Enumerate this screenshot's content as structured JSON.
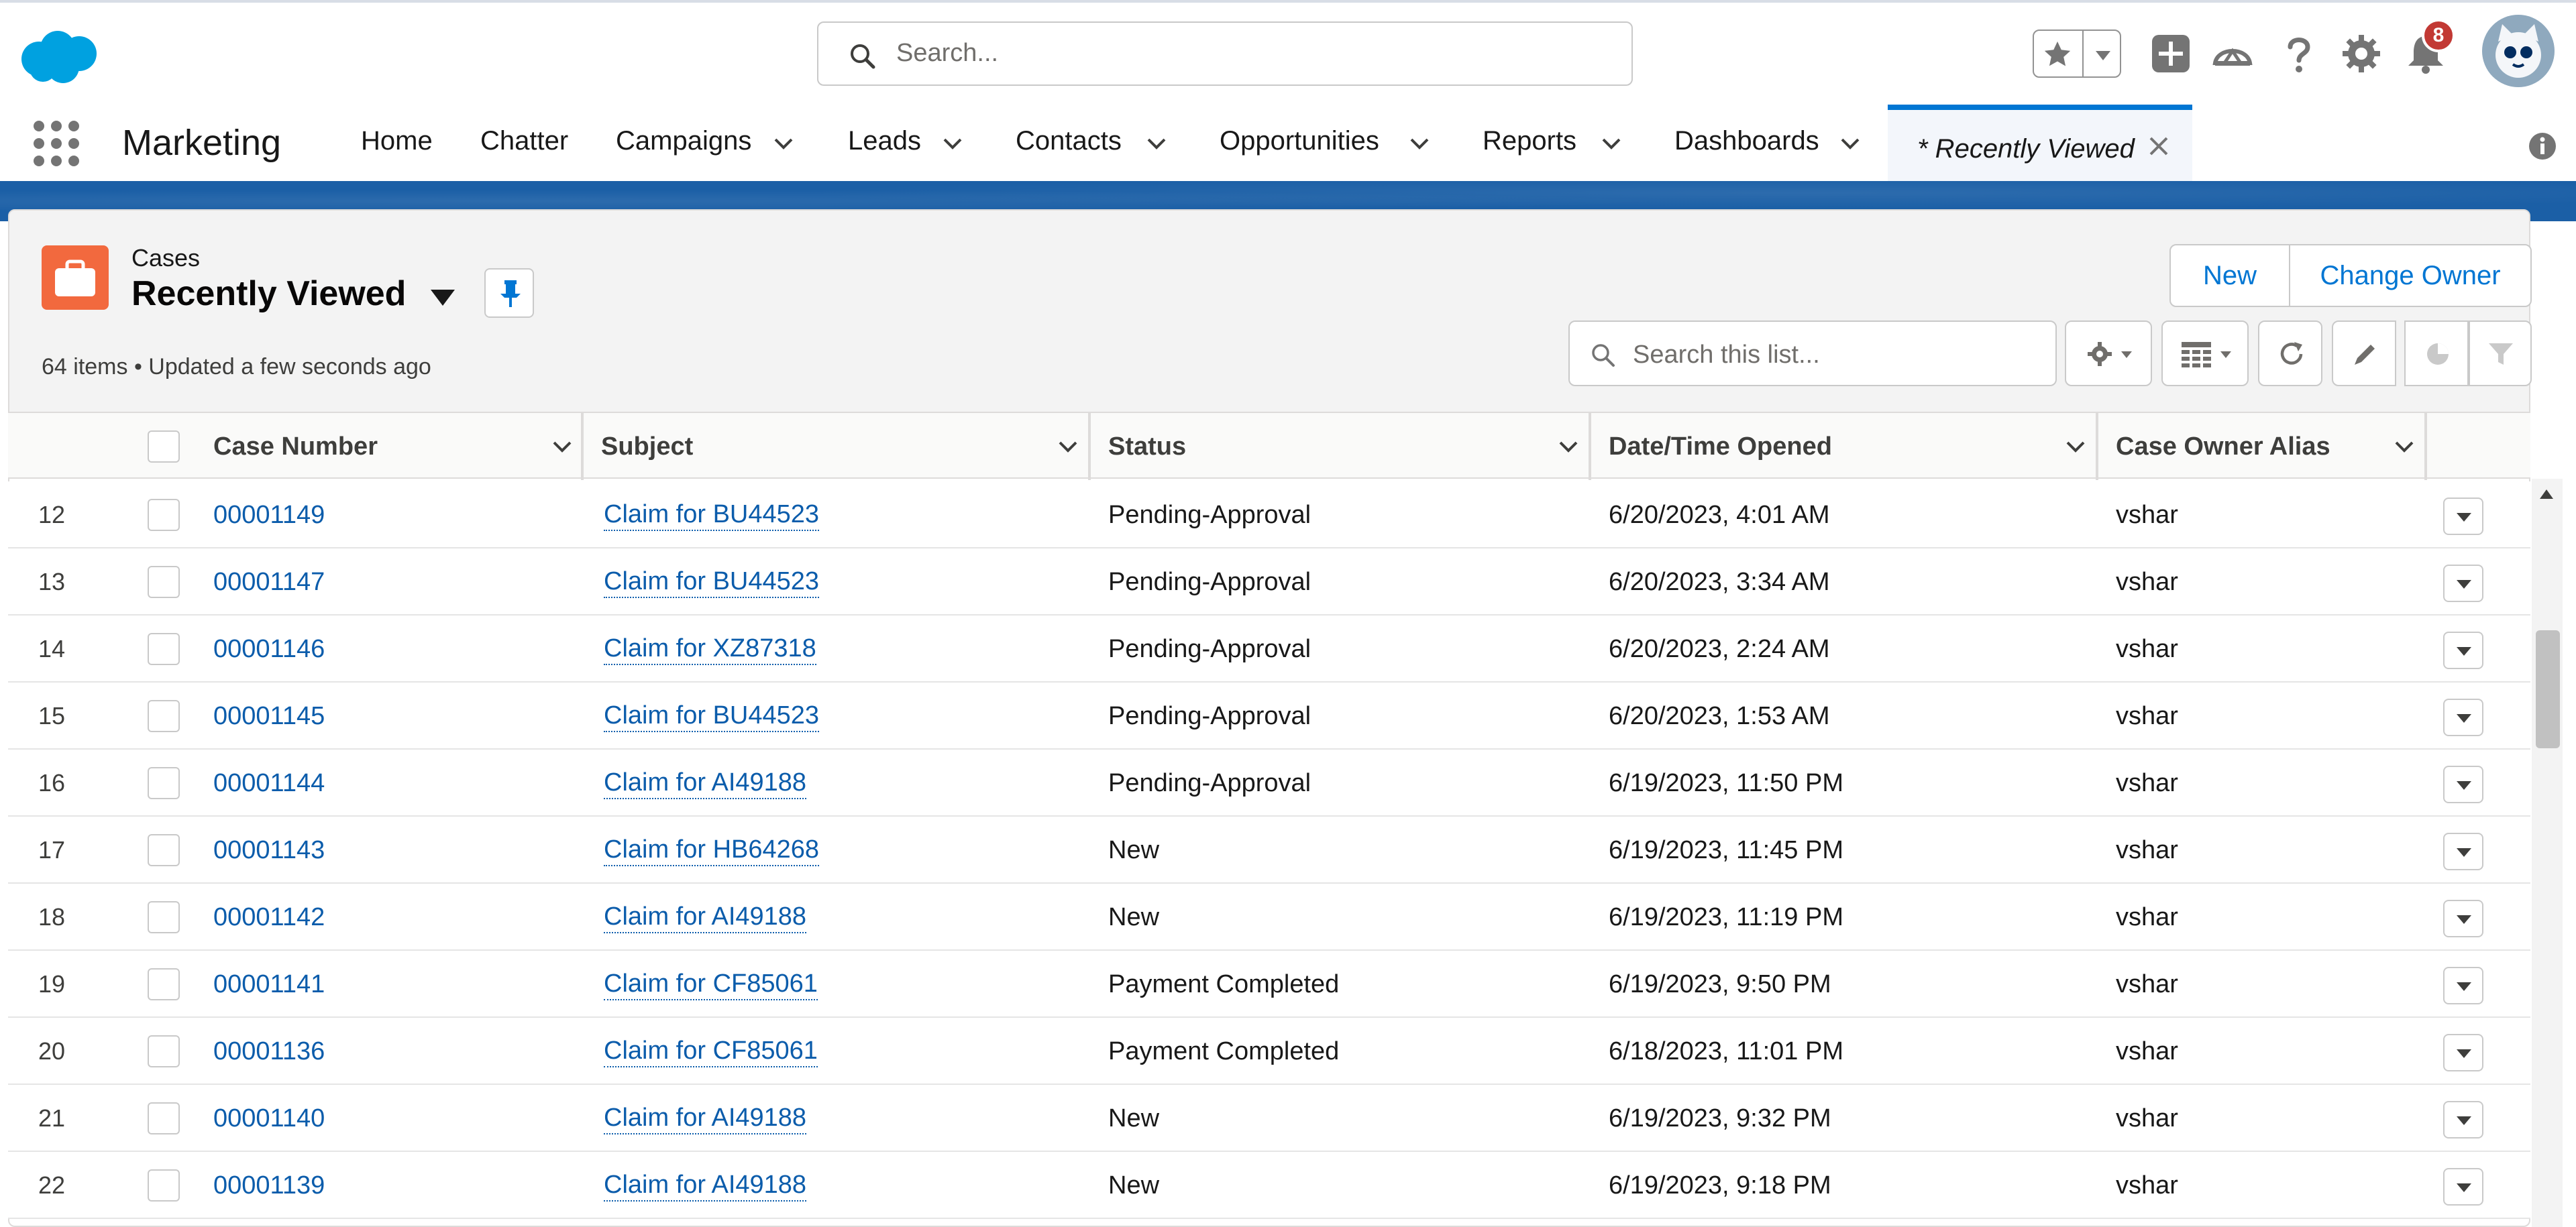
{
  "header": {
    "search_placeholder": "Search...",
    "notification_count": "8"
  },
  "nav": {
    "app_name": "Marketing",
    "items": [
      {
        "label": "Home",
        "has_menu": false
      },
      {
        "label": "Chatter",
        "has_menu": false
      },
      {
        "label": "Campaigns",
        "has_menu": true
      },
      {
        "label": "Leads",
        "has_menu": true
      },
      {
        "label": "Contacts",
        "has_menu": true
      },
      {
        "label": "Opportunities",
        "has_menu": true
      },
      {
        "label": "Reports",
        "has_menu": true
      },
      {
        "label": "Dashboards",
        "has_menu": true
      }
    ],
    "active_tab": "* Recently Viewed"
  },
  "list": {
    "object_label": "Cases",
    "title": "Recently Viewed",
    "meta": "64 items • Updated a few seconds ago",
    "btn_new": "New",
    "btn_change_owner": "Change Owner",
    "search_placeholder": "Search this list..."
  },
  "table": {
    "columns": [
      "Case Number",
      "Subject",
      "Status",
      "Date/Time Opened",
      "Case Owner Alias"
    ],
    "rows": [
      {
        "num": "12",
        "case_number": "00001149",
        "subject": "Claim for BU44523",
        "status": "Pending-Approval",
        "opened": "6/20/2023, 4:01 AM",
        "owner": "vshar"
      },
      {
        "num": "13",
        "case_number": "00001147",
        "subject": "Claim for BU44523",
        "status": "Pending-Approval",
        "opened": "6/20/2023, 3:34 AM",
        "owner": "vshar"
      },
      {
        "num": "14",
        "case_number": "00001146",
        "subject": "Claim for XZ87318",
        "status": "Pending-Approval",
        "opened": "6/20/2023, 2:24 AM",
        "owner": "vshar"
      },
      {
        "num": "15",
        "case_number": "00001145",
        "subject": "Claim for BU44523",
        "status": "Pending-Approval",
        "opened": "6/20/2023, 1:53 AM",
        "owner": "vshar"
      },
      {
        "num": "16",
        "case_number": "00001144",
        "subject": "Claim for AI49188",
        "status": "Pending-Approval",
        "opened": "6/19/2023, 11:50 PM",
        "owner": "vshar"
      },
      {
        "num": "17",
        "case_number": "00001143",
        "subject": "Claim for HB64268",
        "status": "New",
        "opened": "6/19/2023, 11:45 PM",
        "owner": "vshar"
      },
      {
        "num": "18",
        "case_number": "00001142",
        "subject": "Claim for AI49188",
        "status": "New",
        "opened": "6/19/2023, 11:19 PM",
        "owner": "vshar"
      },
      {
        "num": "19",
        "case_number": "00001141",
        "subject": "Claim for CF85061",
        "status": "Payment Completed",
        "opened": "6/19/2023, 9:50 PM",
        "owner": "vshar"
      },
      {
        "num": "20",
        "case_number": "00001136",
        "subject": "Claim for CF85061",
        "status": "Payment Completed",
        "opened": "6/18/2023, 11:01 PM",
        "owner": "vshar"
      },
      {
        "num": "21",
        "case_number": "00001140",
        "subject": "Claim for AI49188",
        "status": "New",
        "opened": "6/19/2023, 9:32 PM",
        "owner": "vshar"
      },
      {
        "num": "22",
        "case_number": "00001139",
        "subject": "Claim for AI49188",
        "status": "New",
        "opened": "6/19/2023, 9:18 PM",
        "owner": "vshar"
      }
    ]
  },
  "colors": {
    "brand_blue": "#0176d3",
    "link": "#0b5cab",
    "case_icon": "#f2693e",
    "badge": "#c23934",
    "band": "#1b5fa6"
  }
}
